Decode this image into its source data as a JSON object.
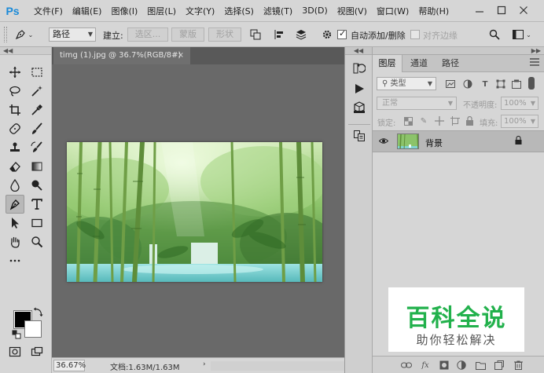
{
  "app": {
    "logo": "Ps",
    "menu": [
      "文件(F)",
      "编辑(E)",
      "图像(I)",
      "图层(L)",
      "文字(Y)",
      "选择(S)",
      "滤镜(T)",
      "3D(D)",
      "视图(V)",
      "窗口(W)",
      "帮助(H)"
    ],
    "window_controls": [
      "minimize",
      "maximize",
      "close"
    ]
  },
  "options_bar": {
    "mode_select": "路径",
    "make_label": "建立:",
    "selection_button": "选区...",
    "mask_button": "蒙版",
    "shape_button": "形状",
    "auto_add_delete": "自动添加/删除",
    "auto_add_delete_checked": true,
    "align_edges": "对齐边缘",
    "align_edges_checked": false,
    "collapse_arrows": "◀◀"
  },
  "tools_panel": {
    "active_tool": "pen-tool",
    "foreground_color": "#000000",
    "background_color": "#ffffff"
  },
  "document": {
    "tab_title": "timg (1).jpg @ 36.7%(RGB/8#)",
    "close_symbol": "×",
    "zoom": "36.67%",
    "doc_info": "文档:1.63M/1.63M",
    "status_arrow": "›"
  },
  "layers_panel": {
    "tabs": [
      "图层",
      "通道",
      "路径"
    ],
    "active_tab": "图层",
    "filter_label": "类型",
    "blend_mode": "正常",
    "opacity_label": "不透明度:",
    "opacity_value": "100%",
    "lock_label": "锁定:",
    "fill_label": "填充:",
    "fill_value": "100%",
    "layers": [
      {
        "name": "背景",
        "visible": true,
        "locked": true
      }
    ]
  },
  "watermark": {
    "title": "百科全说",
    "subtitle": "助你轻松解决"
  },
  "colors": {
    "ps_blue": "#1a8ad8",
    "watermark_green": "#22b14c",
    "ui_gray": "#d6d6d6",
    "canvas_gray": "#696969"
  }
}
